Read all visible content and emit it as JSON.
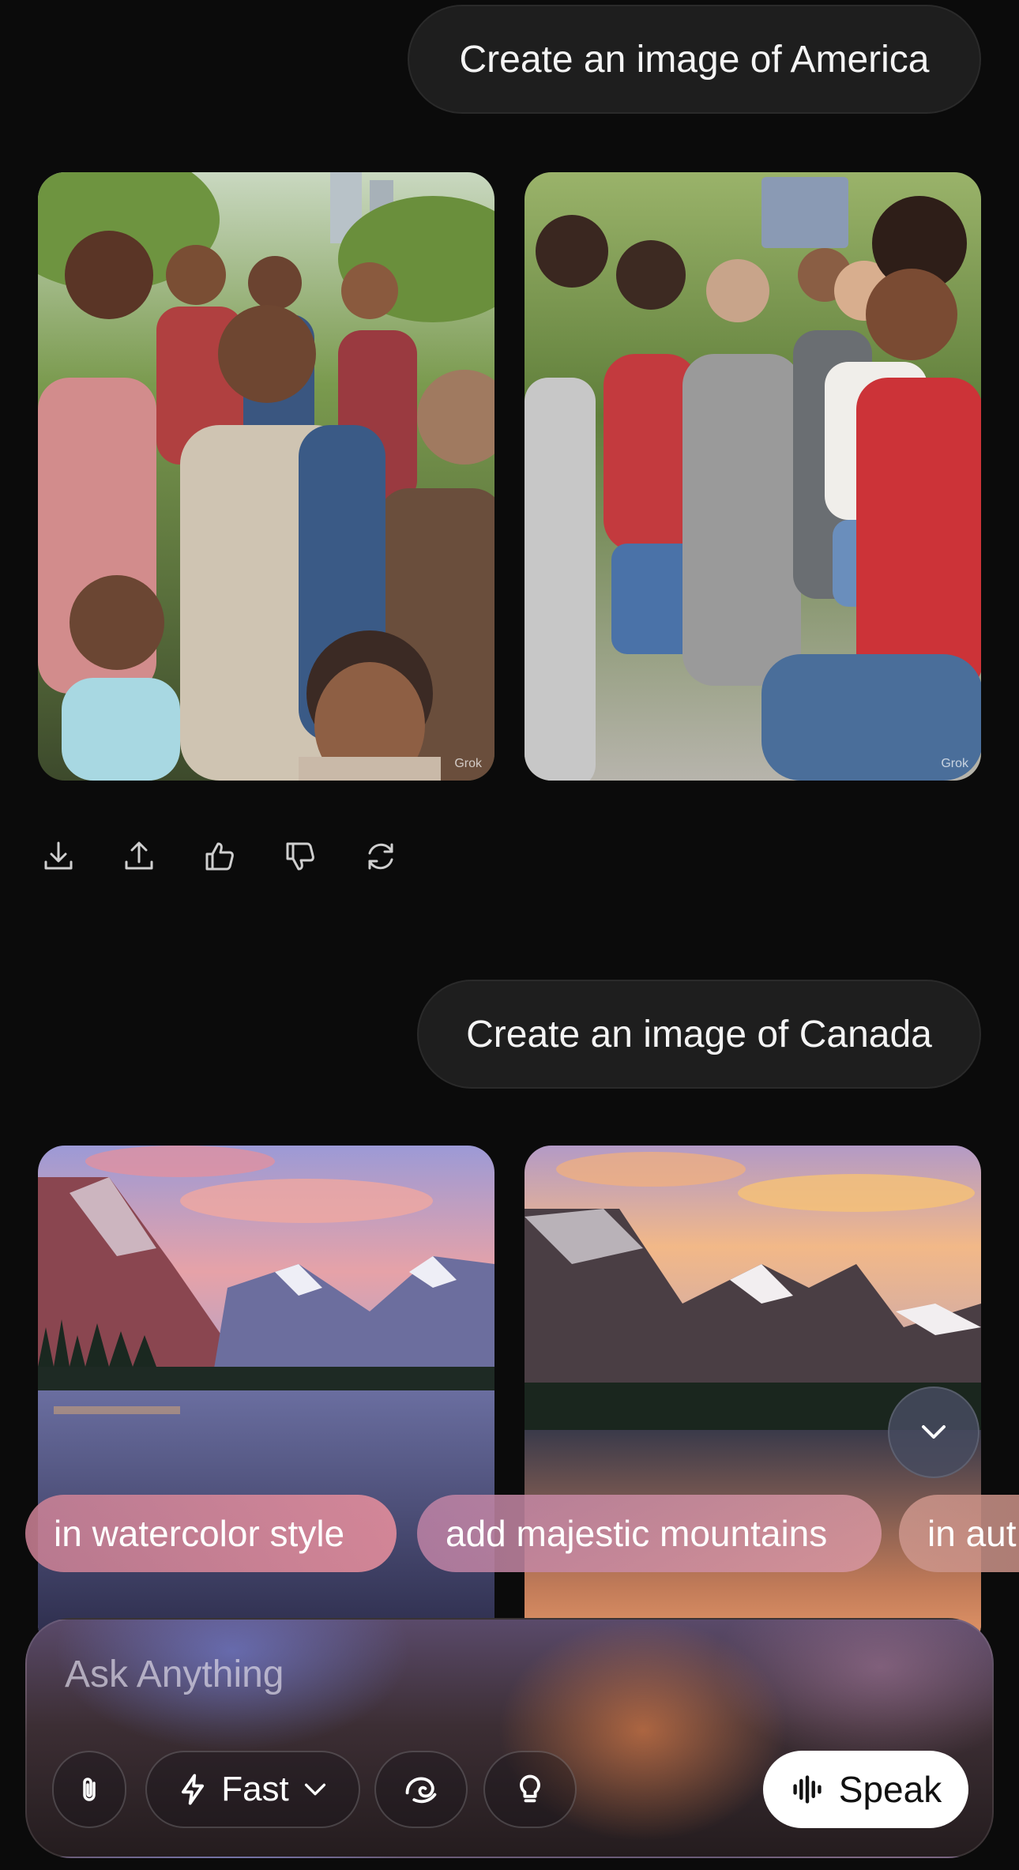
{
  "messages": [
    {
      "prompt": "Create an image of America"
    },
    {
      "prompt": "Create an image of Canada"
    }
  ],
  "images": {
    "watermark": "Grok"
  },
  "actions": [
    {
      "name": "download-icon"
    },
    {
      "name": "share-icon"
    },
    {
      "name": "thumbs-up-icon"
    },
    {
      "name": "thumbs-down-icon"
    },
    {
      "name": "regenerate-icon"
    }
  ],
  "suggestions": [
    "in watercolor style",
    "add majestic mountains",
    "in aut"
  ],
  "composer": {
    "placeholder": "Ask Anything",
    "mode_label": "Fast",
    "speak_label": "Speak"
  },
  "colors": {
    "background": "#0b0b0b",
    "bubble": "#1e1e1e",
    "speak_button": "#ffffff"
  }
}
